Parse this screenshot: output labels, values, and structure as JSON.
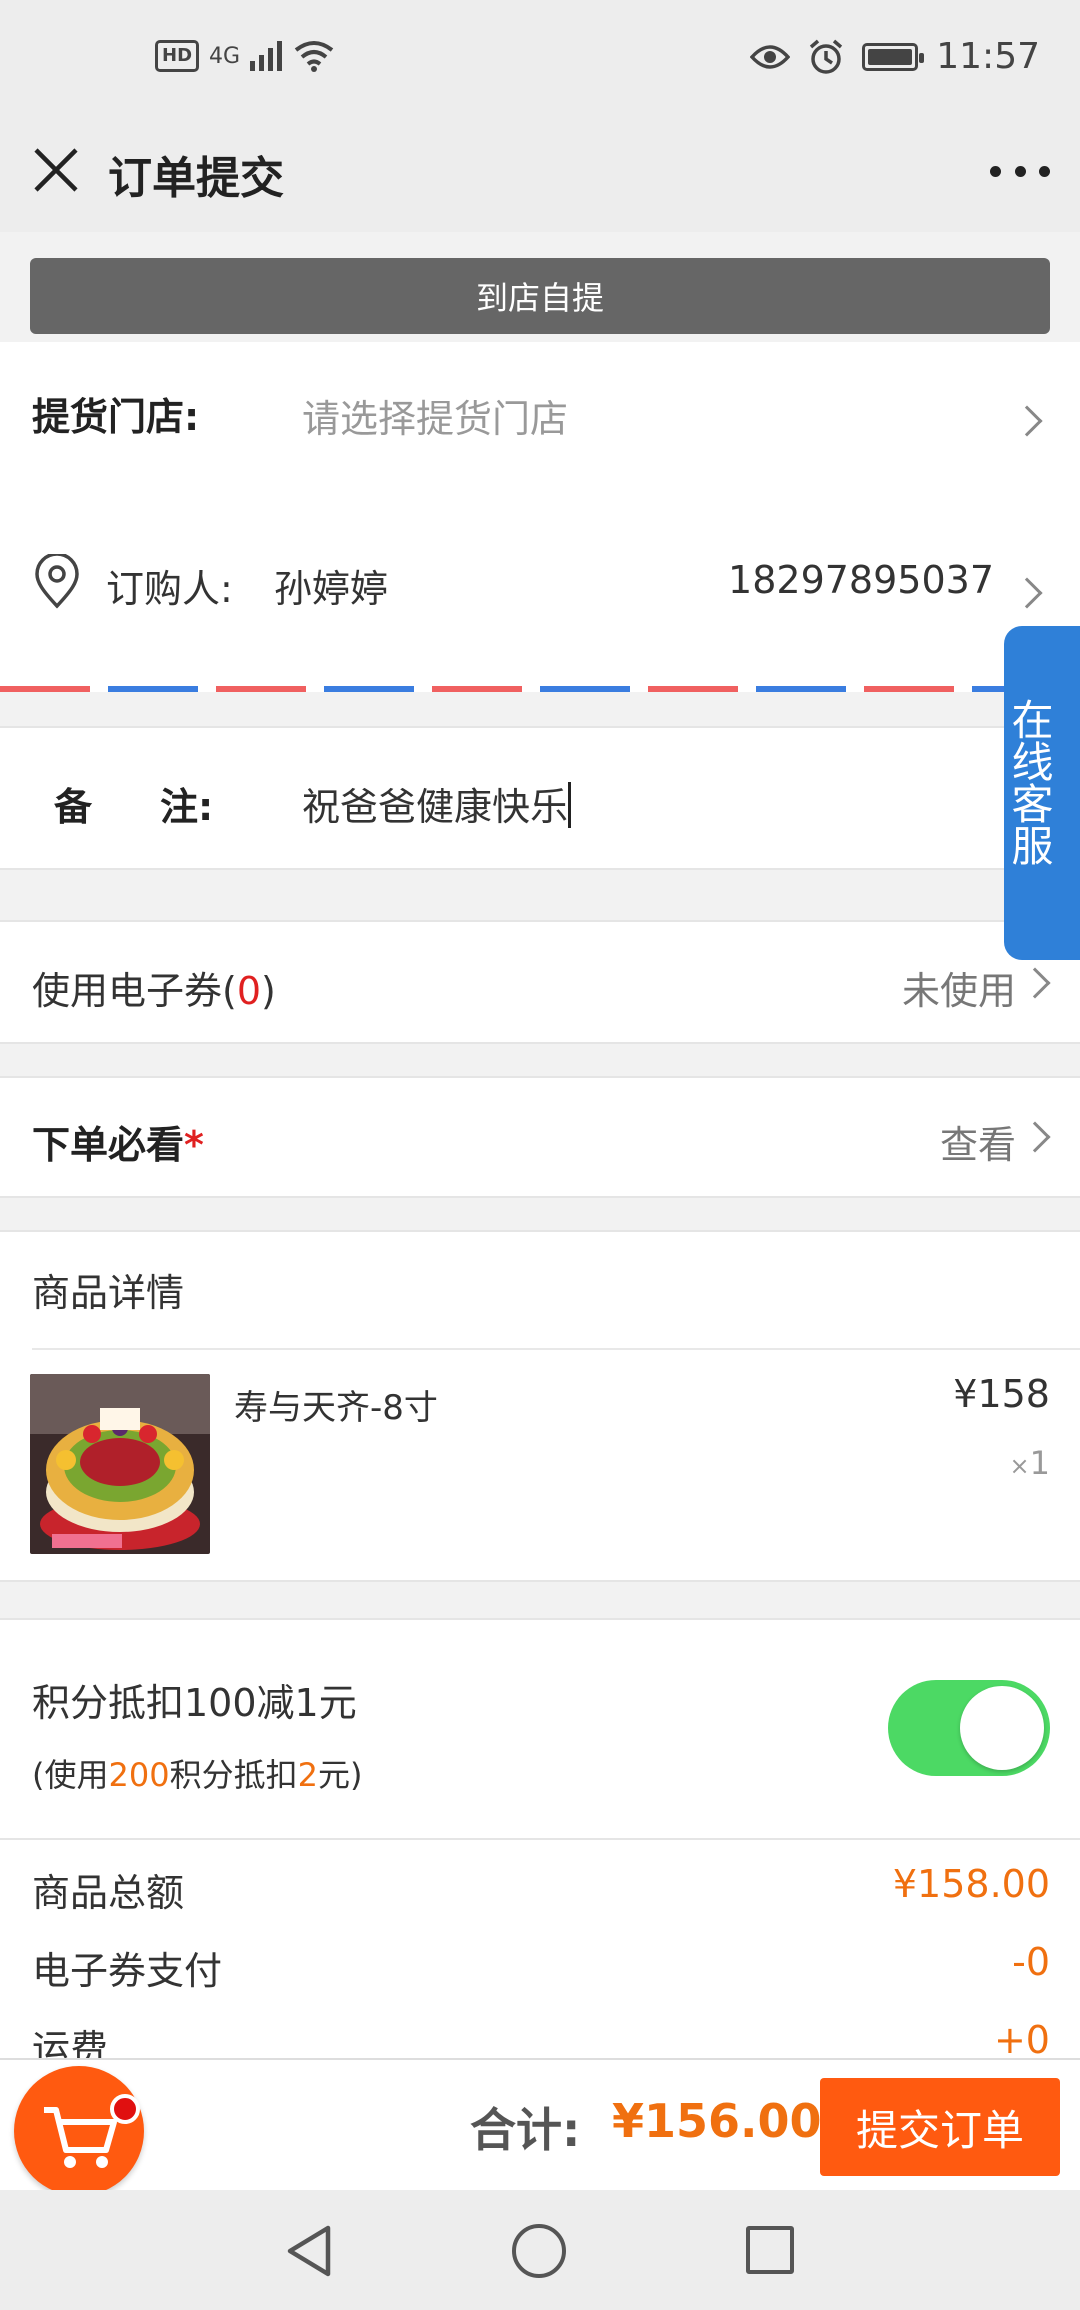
{
  "status_bar": {
    "hd": "HD",
    "network": "4G",
    "time": "11:57"
  },
  "header": {
    "title": "订单提交"
  },
  "delivery": {
    "pickup_button": "到店自提",
    "store_label": "提货门店:",
    "store_placeholder": "请选择提货门店"
  },
  "buyer": {
    "label": "订购人:",
    "name": "孙婷婷",
    "phone": "18297895037"
  },
  "note": {
    "label_left": "备",
    "label_right": "注:",
    "value": "祝爸爸健康快乐"
  },
  "coupon": {
    "label_prefix": "使用电子券(",
    "count": "0",
    "label_suffix": ")",
    "status": "未使用"
  },
  "must_read": {
    "label": "下单必看",
    "required_mark": "*",
    "action": "查看"
  },
  "goods": {
    "section_title": "商品详情",
    "items": [
      {
        "name": "寿与天齐-8寸",
        "price": "¥158",
        "qty_prefix": "×",
        "qty": "1"
      }
    ]
  },
  "points": {
    "title": "积分抵扣100减1元",
    "sub_prefix": "(使用",
    "sub_points": "200",
    "sub_mid": "积分抵扣",
    "sub_amount": "2",
    "sub_suffix": "元)",
    "enabled": true
  },
  "summary": {
    "rows": [
      {
        "label": "商品总额",
        "value": "¥158.00"
      },
      {
        "label": "电子券支付",
        "value": "-0"
      },
      {
        "label": "运费",
        "value": "+0"
      }
    ]
  },
  "bottom": {
    "total_label": "合计:",
    "total_value": "¥156.00",
    "submit": "提交订单"
  },
  "customer_service": {
    "label": "在线客服"
  },
  "colors": {
    "accent_orange": "#ff5a10",
    "price_orange": "#f07010",
    "toggle_green": "#4cd964",
    "cs_blue": "#2f80d8"
  }
}
